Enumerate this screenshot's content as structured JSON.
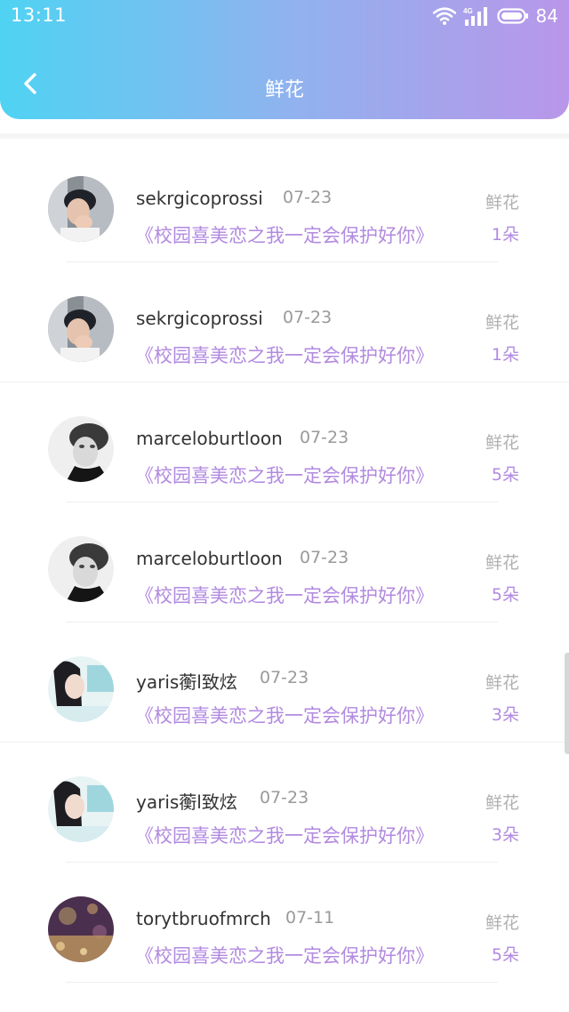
{
  "status_bar": {
    "time": "13:11",
    "network_label": "4G",
    "battery": "84",
    "icons": [
      "wifi-icon",
      "signal-icon",
      "battery-icon"
    ]
  },
  "header": {
    "title": "鲜花",
    "back_icon": "chevron-left-icon",
    "gradient": [
      "#4fd3f3",
      "#b996e9"
    ]
  },
  "colors": {
    "accent": "#b28ae0",
    "name_text": "#333333",
    "muted_text": "#9a9a9a"
  },
  "gift_records": [
    {
      "username": "sekrgicoprossi",
      "date": "07-23",
      "novel": "《校园喜美恋之我一定会保护好你》",
      "gift_label": "鲜花",
      "gift_count": "1朵",
      "avatar": "avatar-boy-hand-on-face"
    },
    {
      "username": "sekrgicoprossi",
      "date": "07-23",
      "novel": "《校园喜美恋之我一定会保护好你》",
      "gift_label": "鲜花",
      "gift_count": "1朵",
      "avatar": "avatar-boy-hand-on-face"
    },
    {
      "username": "marceloburtloon",
      "date": "07-23",
      "novel": "《校园喜美恋之我一定会保护好你》",
      "gift_label": "鲜花",
      "gift_count": "5朵",
      "avatar": "avatar-grayscale-boy"
    },
    {
      "username": "marceloburtloon",
      "date": "07-23",
      "novel": "《校园喜美恋之我一定会保护好你》",
      "gift_label": "鲜花",
      "gift_count": "5朵",
      "avatar": "avatar-grayscale-boy"
    },
    {
      "username": "yaris蘅l致炫",
      "date": "07-23",
      "novel": "《校园喜美恋之我一定会保护好你》",
      "gift_label": "鲜花",
      "gift_count": "3朵",
      "avatar": "avatar-girl-dark-hair"
    },
    {
      "username": "yaris蘅l致炫",
      "date": "07-23",
      "novel": "《校园喜美恋之我一定会保护好你》",
      "gift_label": "鲜花",
      "gift_count": "3朵",
      "avatar": "avatar-girl-dark-hair"
    },
    {
      "username": "torytbruofmrch",
      "date": "07-11",
      "novel": "《校园喜美恋之我一定会保护好你》",
      "gift_label": "鲜花",
      "gift_count": "5朵",
      "avatar": "avatar-purple-bokeh"
    }
  ]
}
